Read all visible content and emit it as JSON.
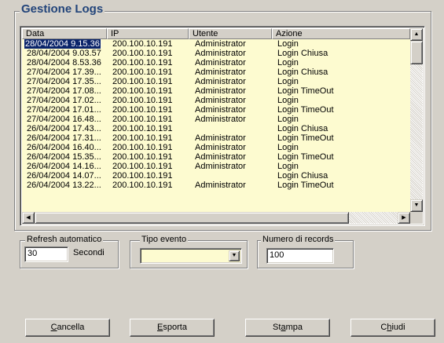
{
  "main": {
    "title": "Gestione Logs",
    "columns": [
      "Data",
      "IP",
      "Utente",
      "Azione"
    ],
    "rows": [
      [
        "28/04/2004 9.15.36",
        "200.100.10.191",
        "Administrator",
        "Login"
      ],
      [
        "28/04/2004 9.03.57",
        "200.100.10.191",
        "Administrator",
        "Login Chiusa"
      ],
      [
        "28/04/2004 8.53.36",
        "200.100.10.191",
        "Administrator",
        "Login"
      ],
      [
        "27/04/2004 17.39...",
        "200.100.10.191",
        "Administrator",
        "Login Chiusa"
      ],
      [
        "27/04/2004 17.35...",
        "200.100.10.191",
        "Administrator",
        "Login"
      ],
      [
        "27/04/2004 17.08...",
        "200.100.10.191",
        "Administrator",
        "Login TimeOut"
      ],
      [
        "27/04/2004 17.02...",
        "200.100.10.191",
        "Administrator",
        "Login"
      ],
      [
        "27/04/2004 17.01...",
        "200.100.10.191",
        "Administrator",
        "Login TimeOut"
      ],
      [
        "27/04/2004 16.48...",
        "200.100.10.191",
        "Administrator",
        "Login"
      ],
      [
        "26/04/2004 17.43...",
        "200.100.10.191",
        "",
        "Login Chiusa"
      ],
      [
        "26/04/2004 17.31...",
        "200.100.10.191",
        "Administrator",
        "Login TimeOut"
      ],
      [
        "26/04/2004 16.40...",
        "200.100.10.191",
        "Administrator",
        "Login"
      ],
      [
        "26/04/2004 15.35...",
        "200.100.10.191",
        "Administrator",
        "Login TimeOut"
      ],
      [
        "26/04/2004 14.16...",
        "200.100.10.191",
        "Administrator",
        "Login"
      ],
      [
        "26/04/2004 14.07...",
        "200.100.10.191",
        "",
        "Login Chiusa"
      ],
      [
        "26/04/2004 13.22...",
        "200.100.10.191",
        "Administrator",
        "Login TimeOut"
      ]
    ],
    "selected_row": 0
  },
  "refresh": {
    "title": "Refresh automatico",
    "value": "30",
    "unit": "Secondi"
  },
  "event_type": {
    "title": "Tipo evento",
    "value": ""
  },
  "records": {
    "title": "Numero di records",
    "value": "100"
  },
  "buttons": {
    "cancel": {
      "underline": "C",
      "rest": "ancella"
    },
    "export": {
      "underline": "E",
      "rest": "sporta"
    },
    "print": {
      "pre": "St",
      "underline": "a",
      "rest": "mpa"
    },
    "close": {
      "pre": "C",
      "underline": "h",
      "rest": "iudi"
    }
  },
  "colors": {
    "list_background": "#fdfbd0",
    "title": "#22447a",
    "selection": "#0a246a"
  }
}
